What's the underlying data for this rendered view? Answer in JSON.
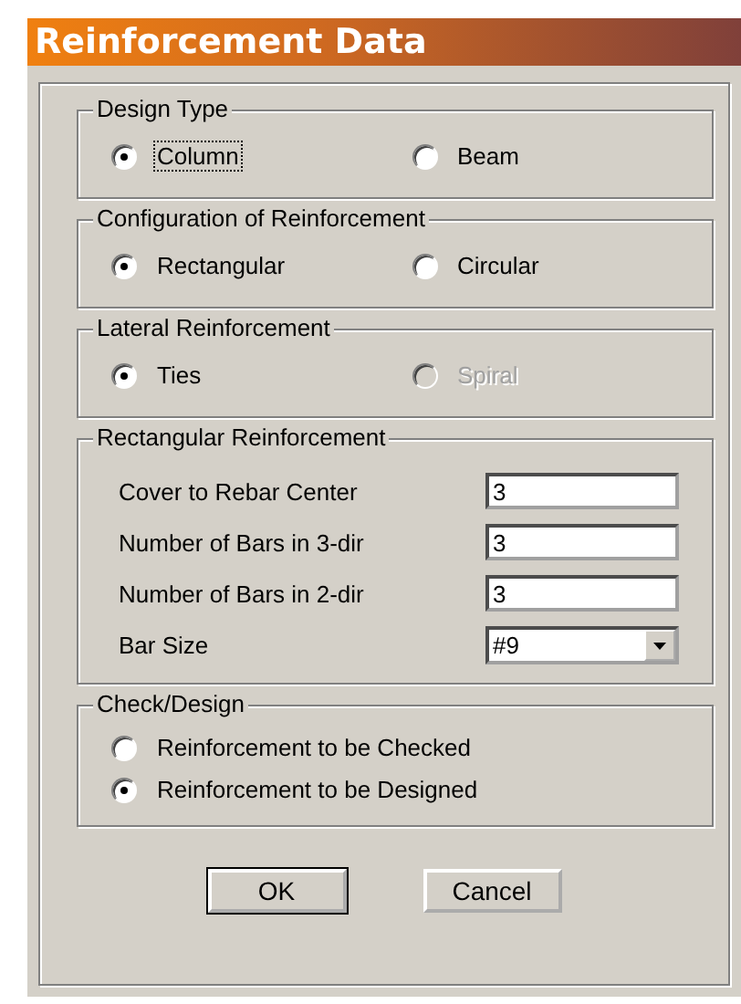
{
  "window": {
    "title": "Reinforcement Data"
  },
  "groups": [
    {
      "kind": "radio-row",
      "title": "Design Type",
      "options": [
        {
          "label": "Column",
          "selected": true,
          "focused": true,
          "disabled": false
        },
        {
          "label": "Beam",
          "selected": false,
          "focused": false,
          "disabled": false
        }
      ]
    },
    {
      "kind": "radio-row",
      "title": "Configuration of Reinforcement",
      "options": [
        {
          "label": "Rectangular",
          "selected": true,
          "focused": false,
          "disabled": false
        },
        {
          "label": "Circular",
          "selected": false,
          "focused": false,
          "disabled": false
        }
      ]
    },
    {
      "kind": "radio-row",
      "title": "Lateral Reinforcement",
      "options": [
        {
          "label": "Ties",
          "selected": true,
          "focused": false,
          "disabled": false
        },
        {
          "label": "Spiral",
          "selected": false,
          "focused": false,
          "disabled": true
        }
      ]
    },
    {
      "kind": "fields",
      "title": "Rectangular Reinforcement",
      "fields": [
        {
          "kind": "text",
          "label": "Cover to Rebar Center",
          "value": "3"
        },
        {
          "kind": "text",
          "label": "Number of Bars in 3-dir",
          "value": "3"
        },
        {
          "kind": "text",
          "label": "Number of Bars in 2-dir",
          "value": "3"
        },
        {
          "kind": "select",
          "label": "Bar Size",
          "value": "#9"
        }
      ]
    },
    {
      "kind": "radio-list",
      "title": "Check/Design",
      "options": [
        {
          "label": "Reinforcement to be Checked",
          "selected": false,
          "focused": false,
          "disabled": false
        },
        {
          "label": "Reinforcement to be Designed",
          "selected": true,
          "focused": false,
          "disabled": false
        }
      ]
    }
  ],
  "buttons": [
    {
      "label": "OK",
      "default": true
    },
    {
      "label": "Cancel",
      "default": false
    }
  ]
}
